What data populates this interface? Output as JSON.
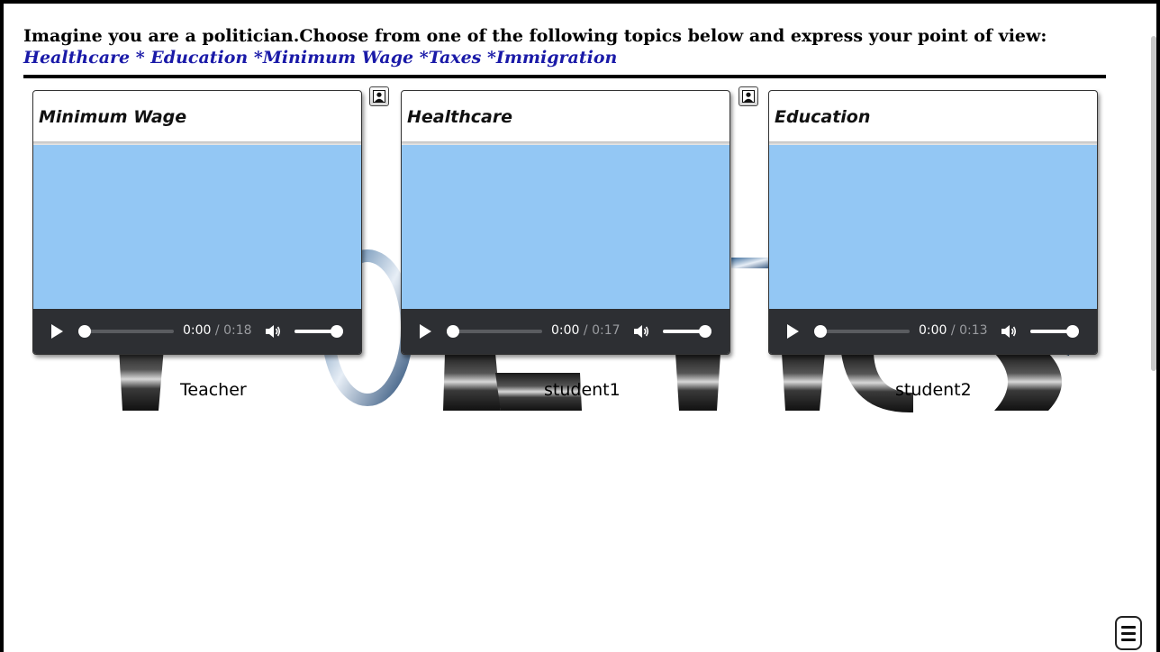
{
  "header": {
    "prompt": "Imagine you are a politician.Choose from one of the following topics below and express your point of view:",
    "topics": "Healthcare * Education *Minimum Wage *Taxes *Immigration"
  },
  "background_word": "POLITICS",
  "cards": [
    {
      "title": "Minimum Wage",
      "time_current": "0:00",
      "time_separator": "/",
      "time_duration": "0:18",
      "owner": "Teacher"
    },
    {
      "title": "Healthcare",
      "time_current": "0:00",
      "time_separator": "/",
      "time_duration": "0:17",
      "owner": "student1"
    },
    {
      "title": "Education",
      "time_current": "0:00",
      "time_separator": "/",
      "time_duration": "0:13",
      "owner": "student2"
    }
  ],
  "icons": {
    "play": "play-icon",
    "volume": "volume-icon",
    "user": "user-portrait-icon",
    "menu": "hamburger-menu-icon"
  },
  "colors": {
    "topics_link": "#1a1aa8",
    "video_area": "#93c7f4",
    "controls_bar": "#2d2f33"
  }
}
